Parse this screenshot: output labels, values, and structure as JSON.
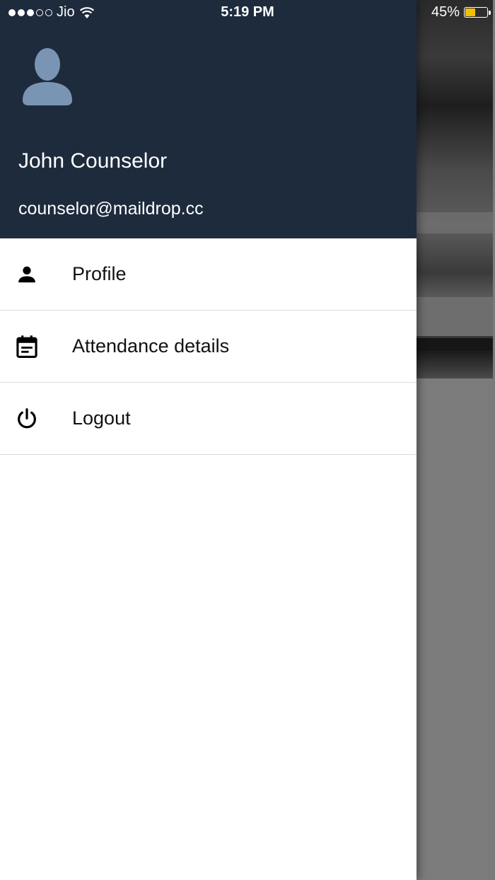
{
  "status_bar": {
    "carrier": "Jio",
    "time": "5:19 PM",
    "battery_percent": "45%",
    "battery_level": 0.45,
    "signal_bars_filled": 3,
    "signal_bars_total": 5,
    "battery_color": "#f5c000"
  },
  "drawer": {
    "header_color": "#1d2b3d",
    "avatar_icon": "user-avatar-icon",
    "user_name": "John Counselor",
    "user_email": "counselor@maildrop.cc",
    "menu": [
      {
        "label": "Profile",
        "icon": "person-icon"
      },
      {
        "label": "Attendance details",
        "icon": "calendar-icon"
      },
      {
        "label": "Logout",
        "icon": "power-icon"
      }
    ]
  }
}
